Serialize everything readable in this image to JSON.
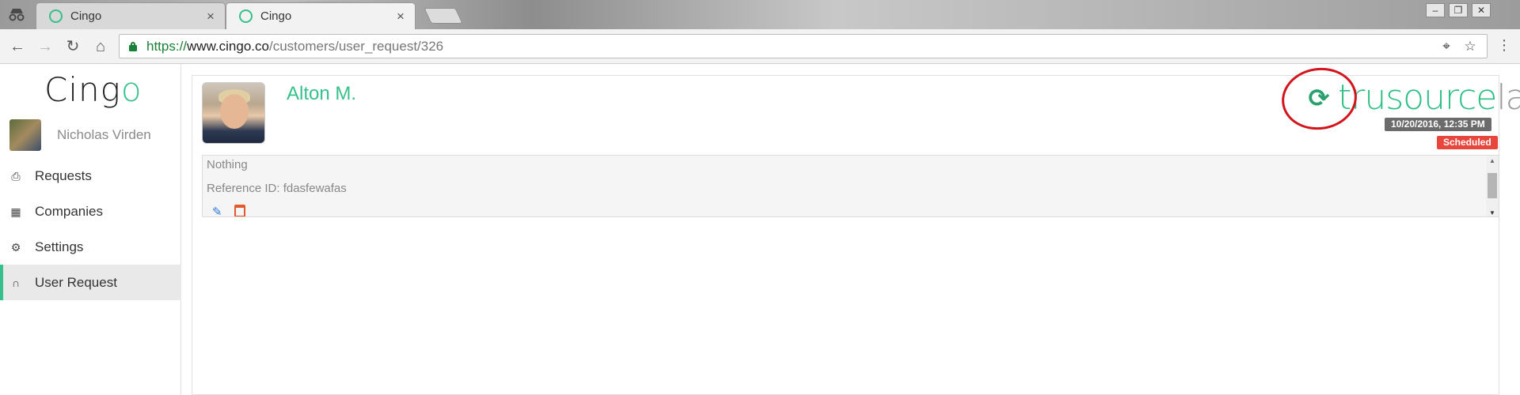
{
  "browser": {
    "tabs": [
      {
        "title": "Cingo",
        "close": "×"
      },
      {
        "title": "Cingo",
        "close": "×"
      }
    ],
    "window_controls": {
      "minimize": "‒",
      "restore": "❐",
      "close": "✕"
    },
    "url": {
      "scheme": "https://",
      "host": "www.cingo.co",
      "path": "/customers/user_request/326"
    },
    "icons": [
      "back-icon",
      "forward-icon",
      "reload-icon",
      "home-icon",
      "lock-icon",
      "location-icon",
      "star-icon",
      "menu-icon"
    ]
  },
  "sidebar": {
    "logo": {
      "main": "Cing",
      "accent": "o"
    },
    "user_name": "Nicholas Virden",
    "items": [
      {
        "label": "Requests",
        "icon": "inbox-icon"
      },
      {
        "label": "Companies",
        "icon": "store-icon"
      },
      {
        "label": "Settings",
        "icon": "gear-icon"
      },
      {
        "label": "User Request",
        "icon": "headset-icon",
        "active": true
      }
    ]
  },
  "request": {
    "customer_name": "Alton M.",
    "brand": {
      "bold": "trusource",
      "light": "labs"
    },
    "date": "10/20/2016, 12:35 PM",
    "status": "Scheduled",
    "description": "Nothing",
    "reference": "Reference ID: fdasfewafas"
  },
  "colors": {
    "accent": "#36c08b",
    "status_scheduled": "#e8453c",
    "date_badge": "#6b6b6b",
    "annotation": "#d4141c"
  }
}
